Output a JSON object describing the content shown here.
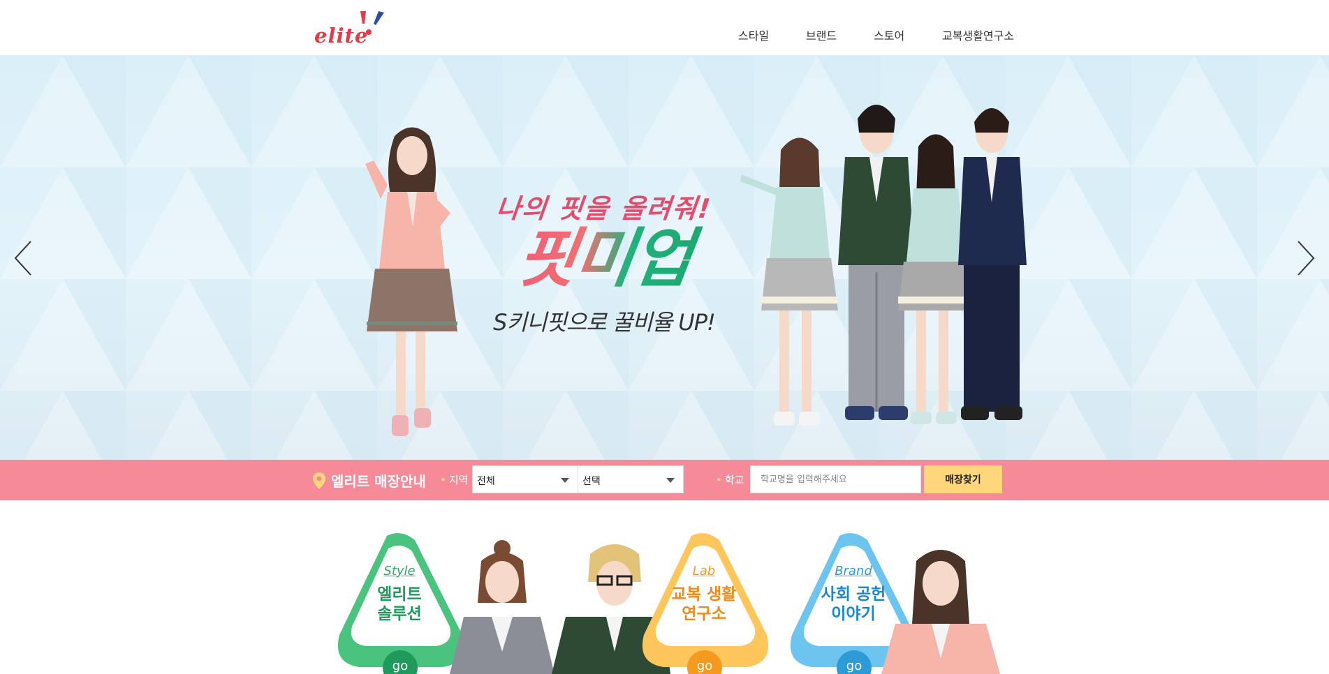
{
  "header": {
    "logo_text": "elite",
    "nav": [
      {
        "label": "스타일"
      },
      {
        "label": "브랜드"
      },
      {
        "label": "스토어"
      },
      {
        "label": "교복생활연구소"
      }
    ]
  },
  "hero": {
    "headline_line1": "나의 핏을 올려줘!",
    "headline_line2": "핏미업",
    "headline_line3": "S키니핏으로 꿀비율 UP!"
  },
  "store_search": {
    "title": "엘리트 매장안내",
    "region_label": "지역",
    "region_select_1": "전체",
    "region_select_2": "선택",
    "school_label": "학교",
    "school_placeholder": "학교명을 입력해주세요",
    "find_button": "매장찾기"
  },
  "promos": [
    {
      "sub": "Style",
      "title": "엘리트\n솔루션",
      "go": "go",
      "color": "#49c37e"
    },
    {
      "sub": "Lab",
      "title": "교복 생활\n연구소",
      "go": "go",
      "color": "#ffc65c"
    },
    {
      "sub": "Brand",
      "title": "사회 공헌\n이야기",
      "go": "go",
      "color": "#6cc5ef"
    }
  ],
  "colors": {
    "logo": "#e23c44",
    "search_bar": "#f68a98",
    "find_button": "#ffd679"
  }
}
